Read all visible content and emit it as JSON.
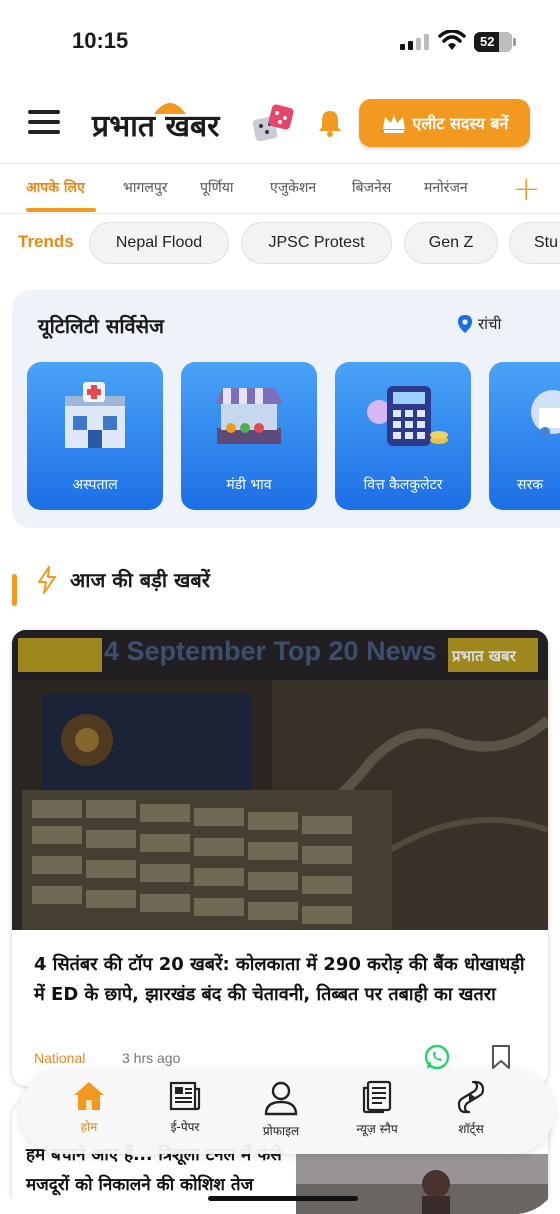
{
  "status_bar": {
    "time": "10:15",
    "battery": "52"
  },
  "header": {
    "logo_text": "प्रभात खबर",
    "elite_button": "एलीट सदस्य बनें"
  },
  "category_tabs": [
    {
      "label": "आपके लिए",
      "active": true
    },
    {
      "label": "भागलपुर"
    },
    {
      "label": "पूर्णिया"
    },
    {
      "label": "एजुकेशन"
    },
    {
      "label": "बिजनेस"
    },
    {
      "label": "मनोरंजन"
    }
  ],
  "trends": {
    "label": "Trends",
    "chips": [
      "Nepal Flood",
      "JPSC Protest",
      "Gen Z",
      "Stu"
    ]
  },
  "utility": {
    "title": "यूटिलिटी सर्विसेज",
    "location": "रांची",
    "tiles": [
      {
        "label": "अस्पताल",
        "icon": "hospital-icon"
      },
      {
        "label": "मंडी भाव",
        "icon": "market-stall-icon"
      },
      {
        "label": "वित्त कैलकुलेटर",
        "icon": "calculator-icon"
      },
      {
        "label": "सरक",
        "icon": "government-icon"
      }
    ]
  },
  "section": {
    "title": "आज की बड़ी खबरें"
  },
  "news_card": {
    "banner_text": "4 September Top 20 News",
    "banner_logo": "प्रभात खबर",
    "headline": "4 सितंबर की टॉप 20 खबरें: कोलकाता में 290 करोड़ की बैंक धोखाधड़ी में ED के छापे, झारखंड बंद की चेतावनी, तिब्बत पर तबाही का खतरा",
    "category": "National",
    "time": "3 hrs ago"
  },
  "card2": {
    "headline": "हम बचाने आए हैं... त्रिशूला टनल में फंसे मजदूरों को निकालने की कोशिश तेज"
  },
  "bottom_nav": [
    {
      "label": "होम",
      "icon": "home-icon",
      "active": true
    },
    {
      "label": "ई-पेपर",
      "icon": "newspaper-icon"
    },
    {
      "label": "प्रोफाइल",
      "icon": "profile-icon"
    },
    {
      "label": "न्यूज़ स्नैप",
      "icon": "news-snap-icon"
    },
    {
      "label": "शॉर्ट्स",
      "icon": "shorts-icon"
    }
  ],
  "colors": {
    "accent": "#f29a1f",
    "tile_blue": "#1c6fe6",
    "text": "#1a1a1a"
  }
}
